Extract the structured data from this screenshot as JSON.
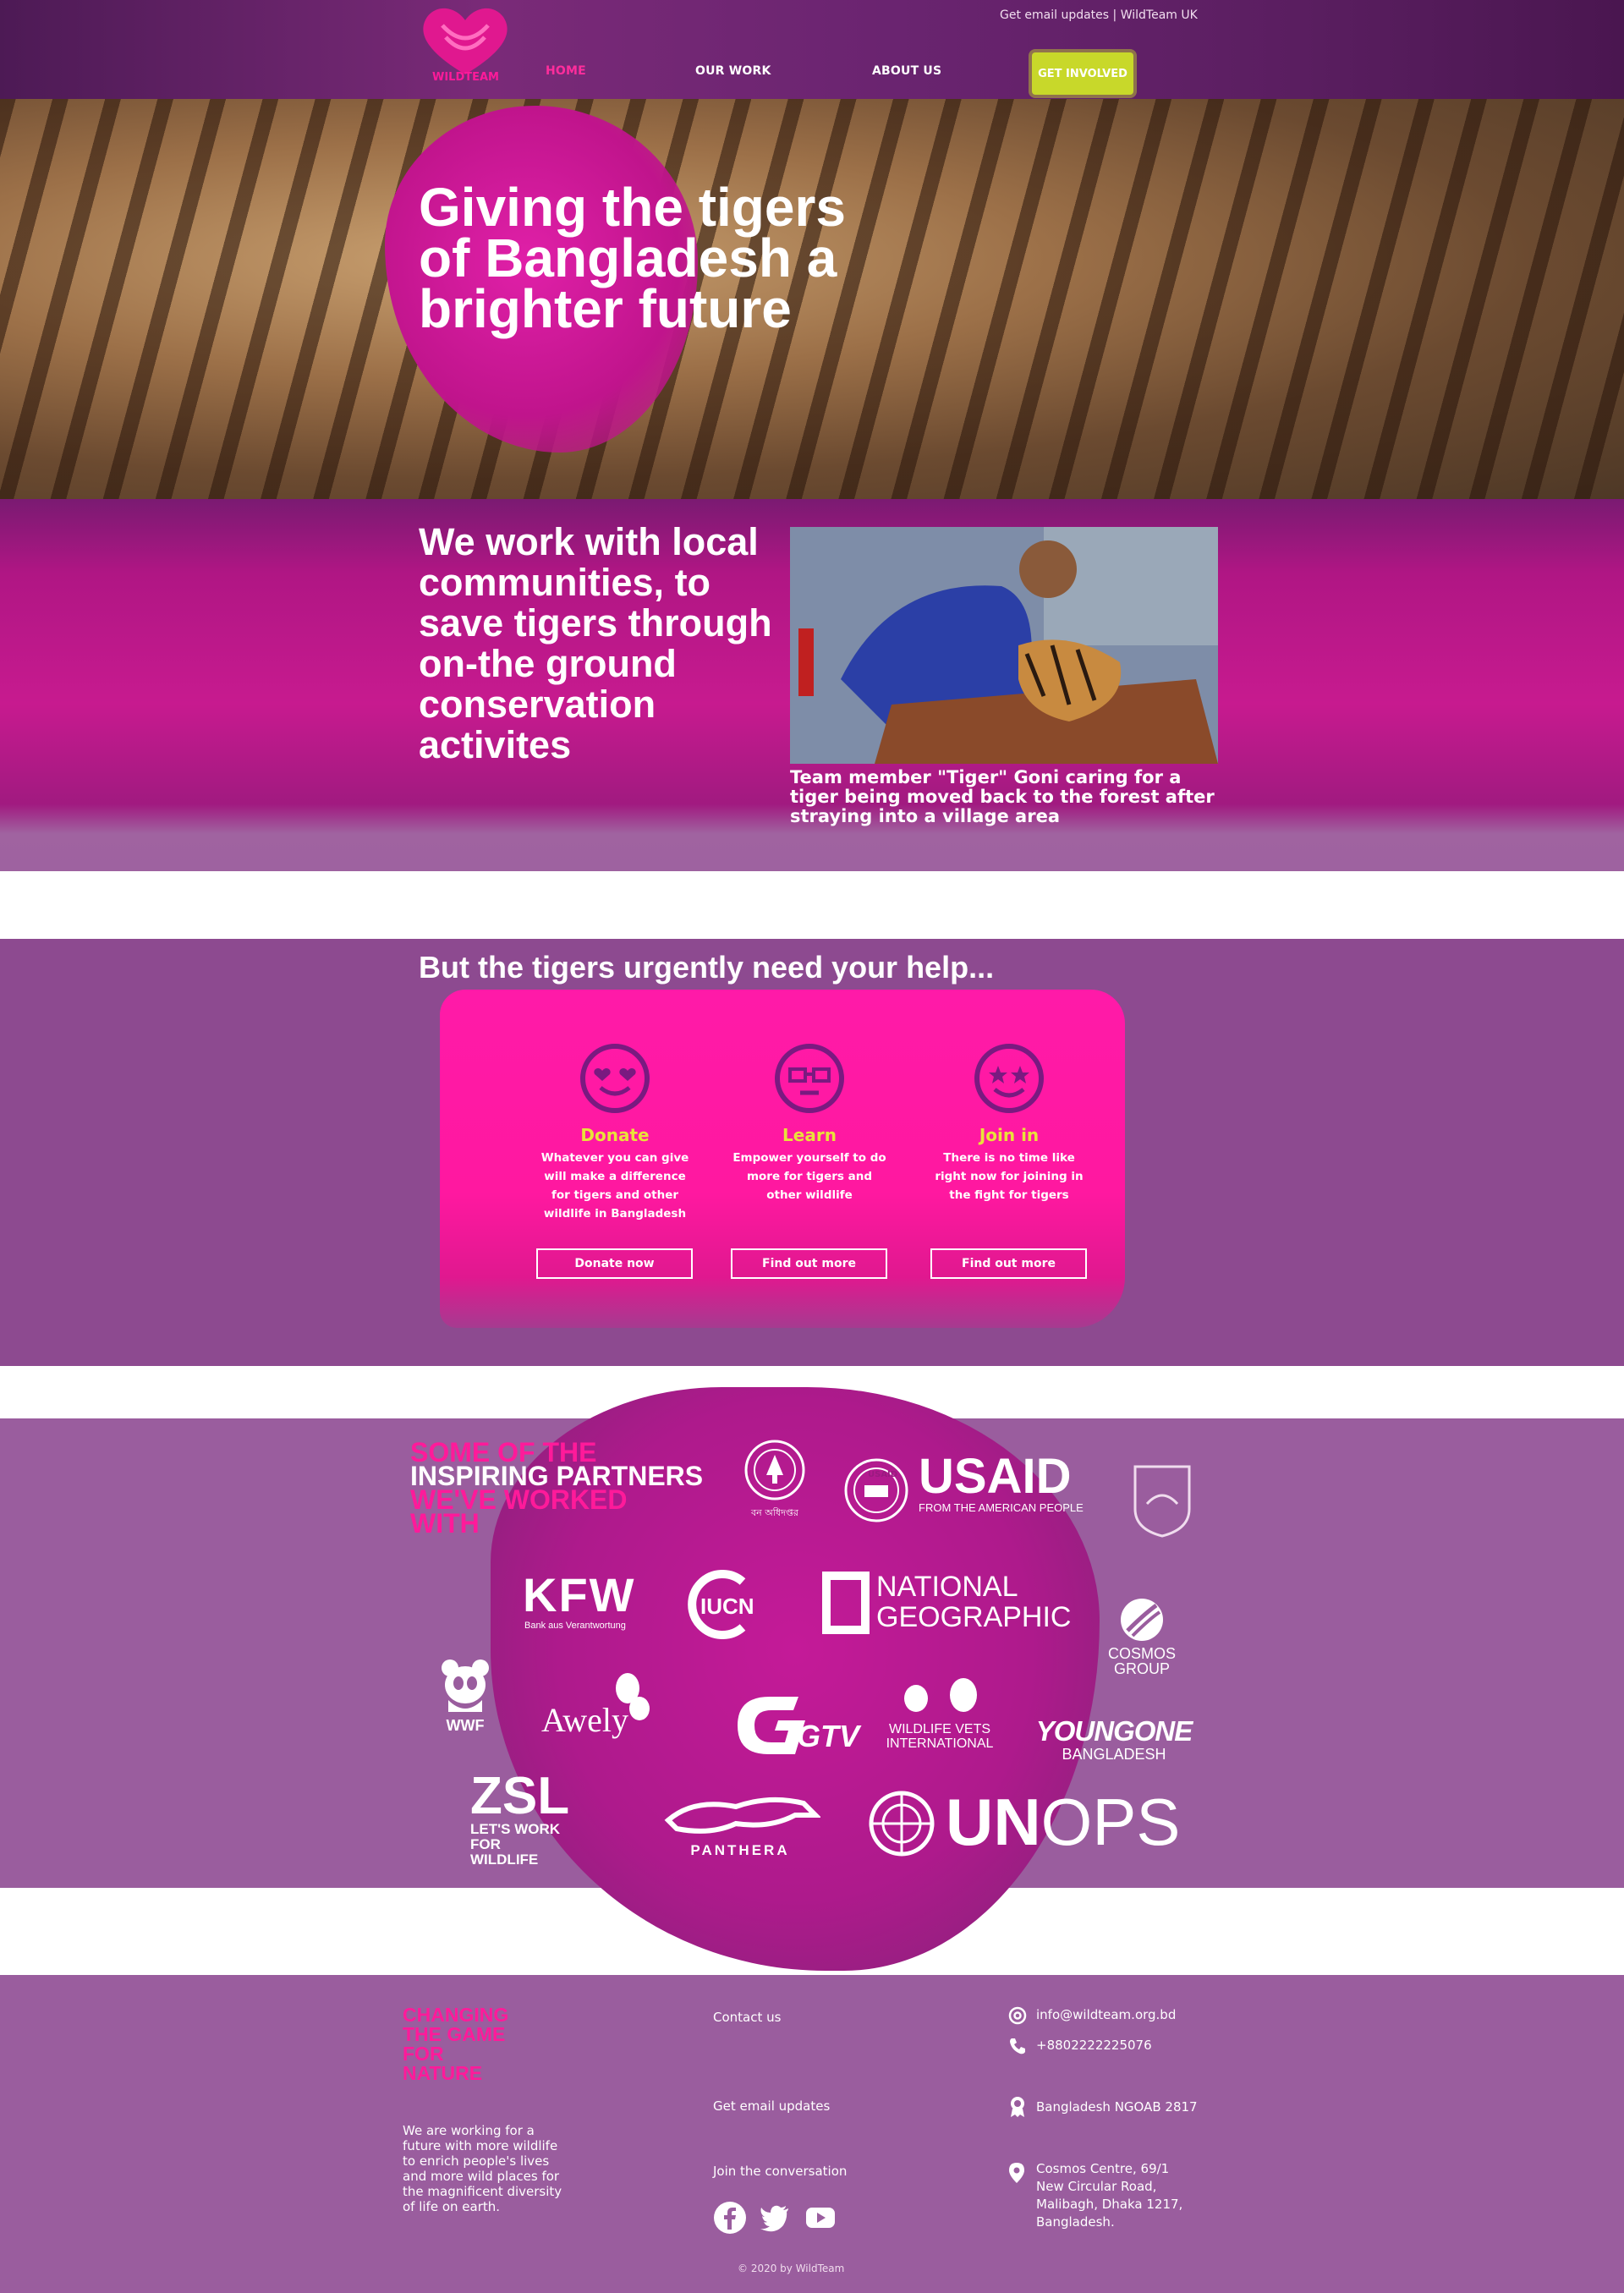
{
  "header": {
    "topline": "Get email updates | WildTeam UK",
    "logo_text": "WILDTEAM",
    "nav": {
      "home": "HOME",
      "our_work": "OUR WORK",
      "about_us": "ABOUT US",
      "get_involved": "GET INVOLVED"
    }
  },
  "hero": {
    "title_lines": [
      "Giving the tigers",
      "of Bangladesh a",
      "brighter future"
    ]
  },
  "mission": {
    "text_lines": [
      "We work with local",
      "communities, to",
      "save tigers through",
      "on-the ground",
      "conservation",
      "activites"
    ],
    "caption": "Team member \"Tiger\" Goni caring for a tiger being moved back to the forest after straying into a village area"
  },
  "help": {
    "title": "But the tigers urgently need your help...",
    "cards": [
      {
        "icon": "heart-eyes-smiley-icon",
        "heading": "Donate",
        "description": "Whatever you can give will make a difference for tigers and other wildlife in Bangladesh",
        "button": "Donate now"
      },
      {
        "icon": "glasses-face-icon",
        "heading": "Learn",
        "description": "Empower yourself to do more for tigers and other wildlife",
        "button": "Find out more"
      },
      {
        "icon": "star-eyes-smiley-icon",
        "heading": "Join in",
        "description": "There is no time like right now for joining in the fight for tigers",
        "button": "Find out more"
      }
    ]
  },
  "partners": {
    "title_lines": [
      {
        "text": "SOME OF THE",
        "color": "pink"
      },
      {
        "text": "INSPIRING PARTNERS",
        "color": "white"
      },
      {
        "text": "WE'VE WORKED",
        "color": "pink"
      },
      {
        "text": "WITH",
        "color": "pink"
      }
    ],
    "logos": {
      "forest_dept": "বন অধিদপ্তর",
      "usaid_main": "USAID",
      "usaid_sub": "FROM THE AMERICAN PEOPLE",
      "usaid_seal": "USAID",
      "kfw": "KFW",
      "kfw_sub": "Bank aus Verantwortung",
      "iucn": "IUCN",
      "natgeo_1": "NATIONAL",
      "natgeo_2": "GEOGRAPHIC",
      "cosmos_1": "COSMOS",
      "cosmos_2": "GROUP",
      "wwf": "WWF",
      "awely": "Awely",
      "gtv": "GTV",
      "wvi_1": "WILDLIFE VETS",
      "wvi_2": "INTERNATIONAL",
      "youngone_1": "YOUNGONE",
      "youngone_2": "BANGLADESH",
      "zsl": "ZSL",
      "zsl_sub_1": "LET'S WORK",
      "zsl_sub_2": "FOR WILDLIFE",
      "panthera": "PANTHERA",
      "unops_1": "UN",
      "unops_2": "OPS"
    }
  },
  "footer": {
    "tagline_lines": [
      "CHANGING",
      "THE GAME",
      "FOR",
      "NATURE"
    ],
    "description": "We are working for a future with more wildlife to enrich people's lives and more wild places for the magnificent diversity of life on earth.",
    "links": {
      "contact": "Contact us",
      "email_updates": "Get email updates",
      "conversation": "Join the conversation"
    },
    "info": {
      "email": "info@wildteam.org.bd",
      "phone": "+8802222225076",
      "ngoab": "Bangladesh NGOAB 2817",
      "address": "Cosmos Centre, 69/1 New Circular Road, Malibagh, Dhaka 1217, Bangladesh."
    },
    "copyright": "© 2020 by WildTeam"
  },
  "colors": {
    "accent_pink": "#ff1a9a",
    "accent_lime": "#c8d82a",
    "purple": "#9a5d9e",
    "heading_yellow": "#e9e23a"
  }
}
